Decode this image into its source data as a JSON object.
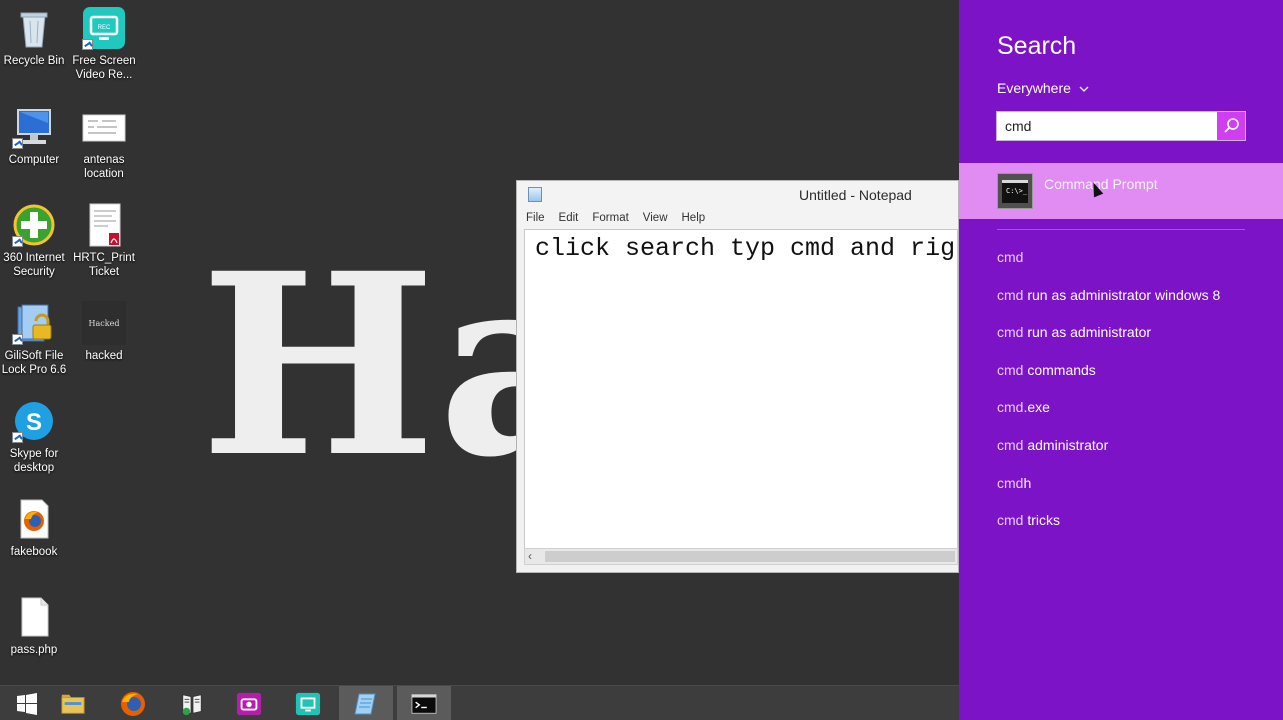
{
  "desktop": {
    "wallpaper_text": "Ha",
    "icons": [
      {
        "name": "recycle-bin",
        "label": "Recycle Bin"
      },
      {
        "name": "free-screen-video-recorder",
        "label": "Free Screen Video Re..."
      },
      {
        "name": "computer",
        "label": "Computer"
      },
      {
        "name": "antenas-location",
        "label": "antenas location"
      },
      {
        "name": "360-internet-security",
        "label": "360 Internet Security"
      },
      {
        "name": "hrtc-print-ticket",
        "label": "HRTC_Print Ticket"
      },
      {
        "name": "gilisoft-file-lock",
        "label": "GiliSoft File Lock Pro 6.6"
      },
      {
        "name": "hacked",
        "label": "hacked",
        "thumb_text": "Hacked"
      },
      {
        "name": "skype-for-desktop",
        "label": "Skype for desktop"
      },
      {
        "name": "fakebook",
        "label": "fakebook"
      },
      {
        "name": "pass-php",
        "label": "pass.php"
      }
    ]
  },
  "notepad": {
    "title": "Untitled - Notepad",
    "menu": [
      "File",
      "Edit",
      "Format",
      "View",
      "Help"
    ],
    "content": "click search typ cmd and right"
  },
  "taskbar": {
    "items": [
      "start-icon",
      "file-explorer-icon",
      "firefox-icon",
      "ebook-icon",
      "camera-app-icon",
      "remote-desktop-icon",
      "notepad-icon",
      "command-prompt-icon"
    ]
  },
  "search": {
    "title": "Search",
    "scope": "Everywhere",
    "query": "cmd",
    "top_result": {
      "label": "Command Prompt",
      "icon_text": "C:\\>_"
    },
    "suggestions": [
      {
        "query": "cmd",
        "rest": ""
      },
      {
        "query": "cmd",
        "rest": " run as administrator windows 8"
      },
      {
        "query": "cmd",
        "rest": " run as administrator"
      },
      {
        "query": "cmd",
        "rest": " commands"
      },
      {
        "query": "cmd",
        "rest": ".exe"
      },
      {
        "query": "cmd",
        "rest": " administrator"
      },
      {
        "query": "cmd",
        "rest": "h"
      },
      {
        "query": "cmd",
        "rest": " tricks"
      }
    ],
    "colors": {
      "panel": "#7d13c7",
      "highlight": "#e18cf3",
      "button": "#cf3ff0"
    }
  }
}
